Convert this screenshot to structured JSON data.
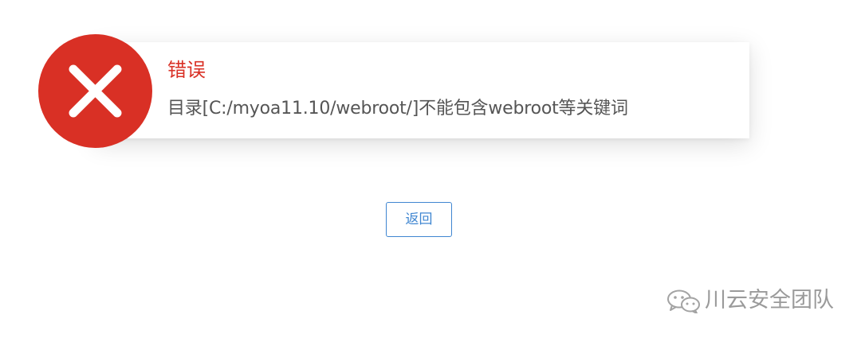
{
  "error": {
    "title": "错误",
    "message": "目录[C:/myoa11.10/webroot/]不能包含webroot等关键词",
    "icon": "error-x-icon",
    "color": "#d93025"
  },
  "actions": {
    "back_label": "返回",
    "accent": "#3f86d1"
  },
  "watermark": {
    "icon": "wechat-icon",
    "text": "川云安全团队"
  }
}
